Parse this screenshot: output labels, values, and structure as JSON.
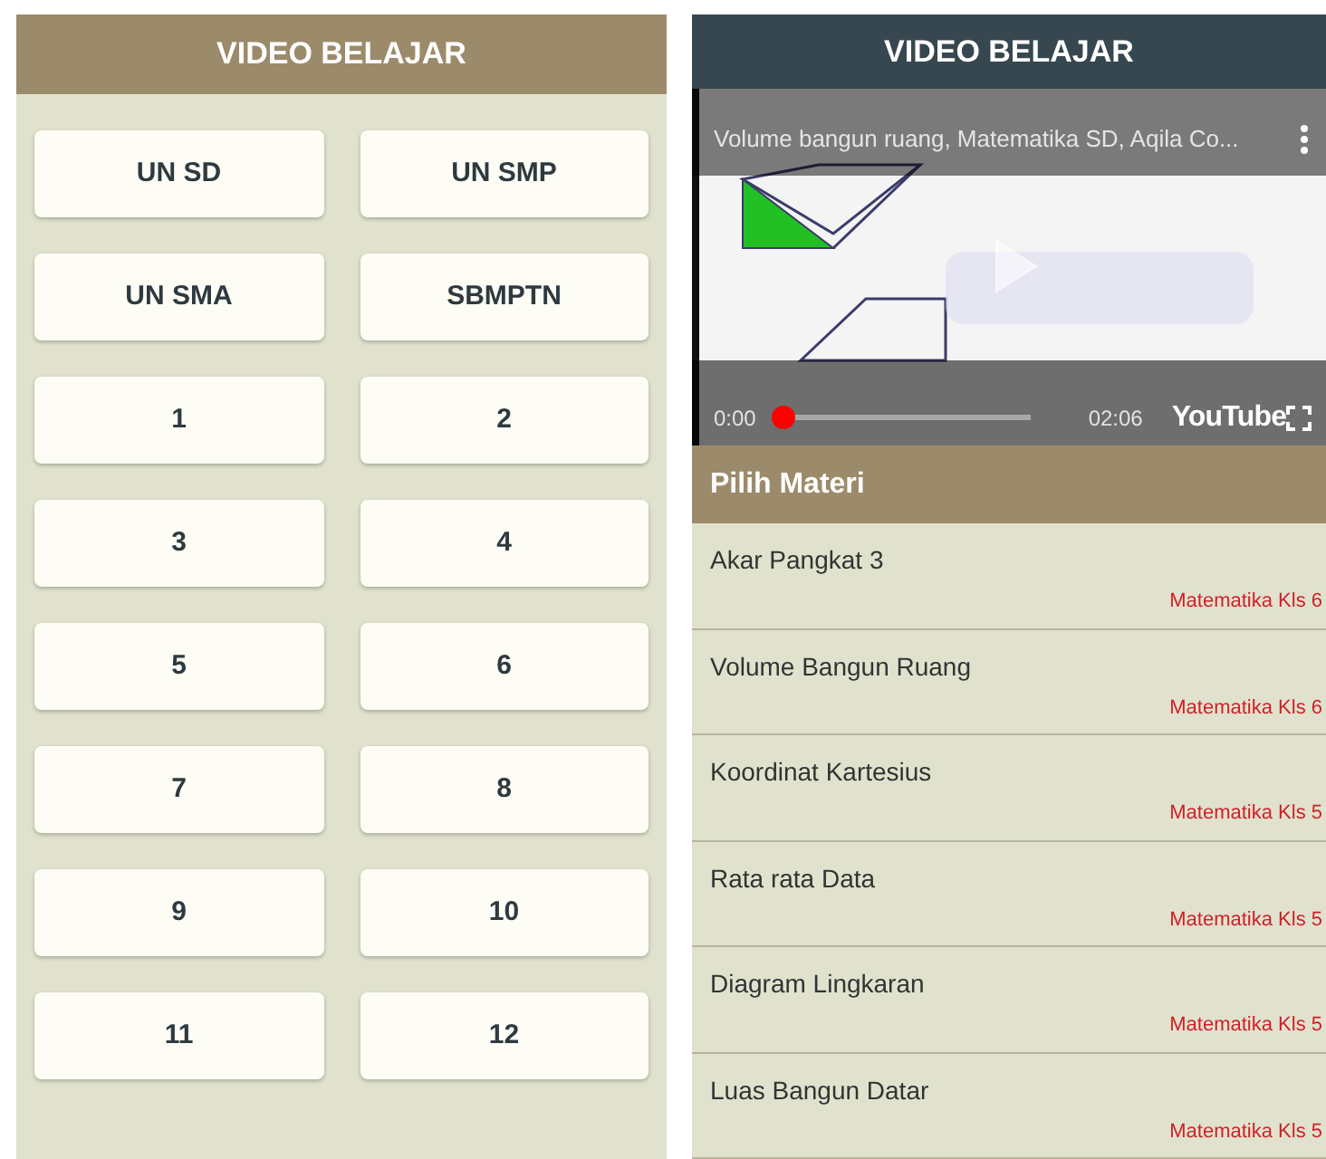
{
  "left_screen": {
    "title": "VIDEO BELAJAR",
    "buttons": [
      "UN SD",
      "UN SMP",
      "UN SMA",
      "SBMPTN",
      "1",
      "2",
      "3",
      "4",
      "5",
      "6",
      "7",
      "8",
      "9",
      "10",
      "11",
      "12"
    ]
  },
  "right_screen": {
    "title": "VIDEO BELAJAR",
    "video": {
      "kind": "picture",
      "title": "Volume bangun ruang, Matematika SD, Aqila Co...",
      "current_time": "0:00",
      "duration": "02:06",
      "logo": "YouTube",
      "level": 0
    },
    "section_title": "Pilih Materi",
    "items": [
      {
        "title": "Akar Pangkat 3",
        "subtitle": "Matematika Kls 6"
      },
      {
        "title": "Volume Bangun Ruang",
        "subtitle": "Matematika Kls 6"
      },
      {
        "title": "Koordinat Kartesius",
        "subtitle": "Matematika Kls 5"
      },
      {
        "title": "Rata rata Data",
        "subtitle": "Matematika Kls 5"
      },
      {
        "title": "Diagram Lingkaran",
        "subtitle": "Matematika Kls 5"
      },
      {
        "title": "Luas Bangun Datar",
        "subtitle": "Matematika Kls 5"
      }
    ]
  }
}
